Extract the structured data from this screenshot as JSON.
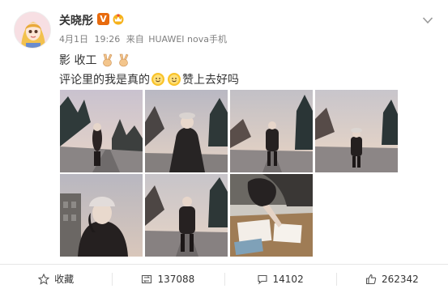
{
  "user": {
    "name": "关晓彤",
    "verified_badge": "V"
  },
  "meta": {
    "date": "4月1日",
    "time": "19:26",
    "source_prefix": "来自",
    "device": "HUAWEI nova手机"
  },
  "post": {
    "line1": "影 收工",
    "line2_a": "评论里的我是真的",
    "line2_b": "赞上去好吗"
  },
  "photos": [
    {
      "name": "photo-1",
      "scene": "road-dusk"
    },
    {
      "name": "photo-2",
      "scene": "hat-road"
    },
    {
      "name": "photo-3",
      "scene": "road-standing"
    },
    {
      "name": "photo-4",
      "scene": "road-hat-far"
    },
    {
      "name": "photo-5",
      "scene": "building-closeup"
    },
    {
      "name": "photo-6",
      "scene": "walking-road"
    },
    {
      "name": "photo-7",
      "scene": "writing-desk"
    }
  ],
  "actions": {
    "favorite_label": "收藏",
    "repost_count": "137088",
    "comment_count": "14102",
    "like_count": "262342"
  },
  "colors": {
    "accent": "#e86b0e",
    "meta": "#808080",
    "icon": "#555555"
  }
}
